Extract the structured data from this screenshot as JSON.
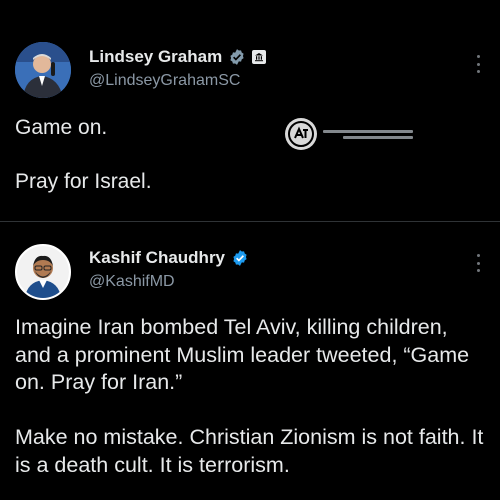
{
  "tweets": [
    {
      "display_name": "Lindsey Graham",
      "handle": "@LindseyGrahamSC",
      "verified": true,
      "verified_color": "#829aab",
      "government_label_icon": "government-building-icon",
      "text": "Game on.\n\nPray for Israel."
    },
    {
      "display_name": "Kashif Chaudhry",
      "handle": "@KashifMD",
      "verified": true,
      "verified_color": "#1d9bf0",
      "text": "Imagine Iran bombed Tel Aviv, killing children, and a prominent Muslim leader tweeted, “Game on. Pray for Iran.”\n\nMake no mistake. Christian Zionism is not faith. It is a death cult. It is terrorism."
    }
  ],
  "icons": {
    "more": "more-options-icon",
    "verified": "verified-badge-icon"
  },
  "colors": {
    "background": "#000000",
    "text_primary": "#e7e9ea",
    "text_secondary": "#8b98a5",
    "divider": "#2f3336"
  }
}
